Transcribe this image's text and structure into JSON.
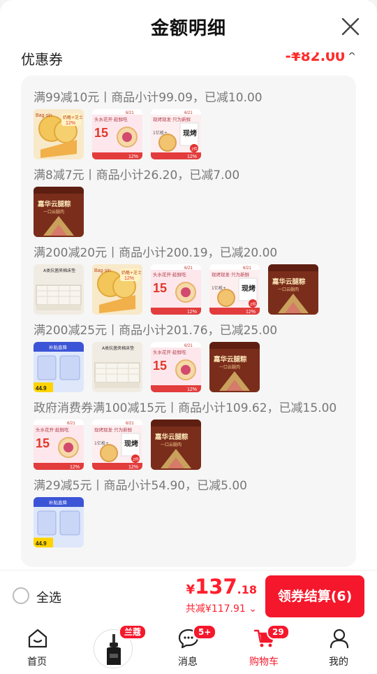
{
  "sheet": {
    "title": "金额明细"
  },
  "coupon": {
    "label": "优惠券",
    "amount": "-¥82.00",
    "caret": "^"
  },
  "groups": [
    {
      "title": "满99减10元丨商品小计99.09，已减10.00",
      "products": [
        "cookie",
        "flower-pastry",
        "baked-pastry"
      ]
    },
    {
      "title": "满8减7元丨商品小计26.20，已减7.00",
      "products": [
        "zongzi"
      ]
    },
    {
      "title": "满200减20元丨商品小计200.19，已减20.00",
      "products": [
        "mattress",
        "cookie",
        "flower-pastry",
        "baked-pastry",
        "zongzi"
      ]
    },
    {
      "title": "满200减25元丨商品小计201.76，已减25.00",
      "products": [
        "diapers",
        "mattress",
        "flower-pastry",
        "zongzi"
      ]
    },
    {
      "title": "政府消费券满100减15元丨商品小计109.62，已减15.00",
      "products": [
        "flower-pastry",
        "baked-pastry",
        "zongzi"
      ]
    },
    {
      "title": "满29减5元丨商品小计54.90，已减5.00",
      "products": [
        "diapers"
      ]
    }
  ],
  "product_texts": {
    "cookie": {
      "brand": "Bag·sin",
      "text": "奶酪+芝士",
      "pct": "12%"
    },
    "flower-pastry": {
      "top": "头水花开·趁鲜吃",
      "big": "15",
      "pct": "12%",
      "date": "6/21"
    },
    "baked-pastry": {
      "top": "现烤现发·只为新鲜",
      "big": "现烤",
      "pct": "12%",
      "date": "6/21",
      "sub": "1亿枚+",
      "tag": "2件"
    },
    "zongzi": {
      "name": "嘉华云腿粽",
      "sub": "一口云腿肉"
    },
    "mattress": {
      "text": "A类抗菌夹棉床垫"
    },
    "diapers": {
      "top": "补贴直降",
      "price": "44.9"
    }
  },
  "checkout": {
    "select_all": "全选",
    "currency": "¥",
    "total_int": "137",
    "total_dec": ".18",
    "saved": "共减¥117.91 ⌄",
    "button": "领券结算(6)"
  },
  "tabs": [
    {
      "label": "首页"
    },
    {
      "label": "",
      "badge": "兰蔻"
    },
    {
      "label": "消息",
      "badge": "5+"
    },
    {
      "label": "购物车",
      "badge": "29"
    },
    {
      "label": "我的"
    }
  ],
  "colors": {
    "accent": "#f5172b",
    "price": "#ff2b2b",
    "panel": "#f6f6f6"
  }
}
